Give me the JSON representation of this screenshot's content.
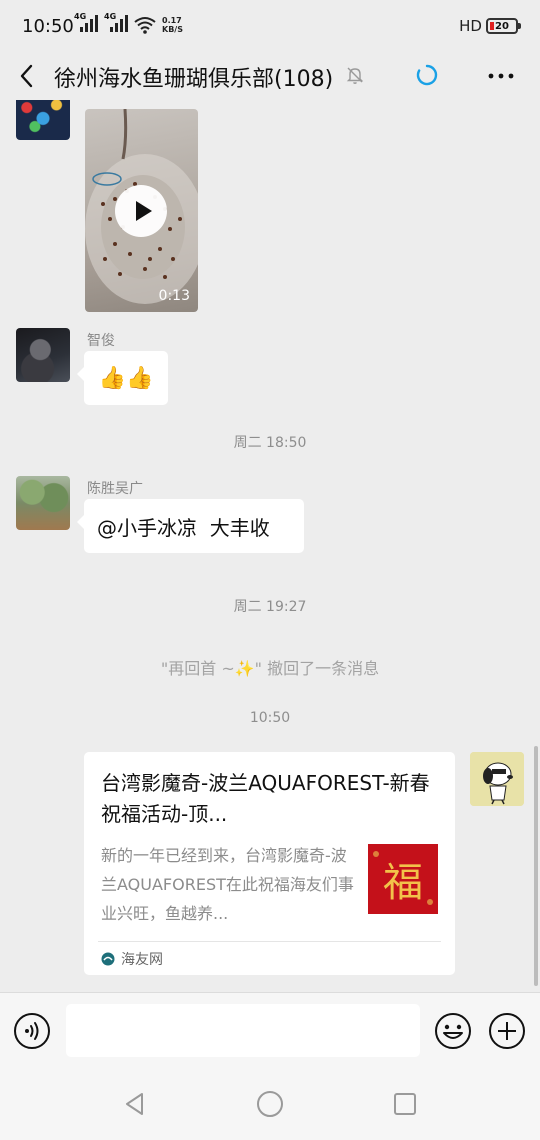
{
  "status_bar": {
    "time": "10:50",
    "network_1": "4G",
    "network_2": "4G",
    "speed_value": "0.17",
    "speed_unit": "KB/S",
    "hd_label": "HD",
    "battery_level": "20"
  },
  "header": {
    "title": "徐州海水鱼珊瑚俱乐部(108)",
    "icons": [
      "back-icon",
      "mute-icon",
      "loading-icon",
      "more-icon"
    ]
  },
  "messages": {
    "video": {
      "duration": "0:13"
    },
    "msg_zhijun": {
      "sender": "智俊",
      "content": "👍👍"
    },
    "time_1": "周二 18:50",
    "msg_chensheng": {
      "sender": "陈胜吴广",
      "content": "@小手冰凉  大丰收"
    },
    "time_2": "周二 19:27",
    "recall_notice": "\"再回首 ~✨\" 撤回了一条消息",
    "time_3": "10:50",
    "share_card": {
      "title": "台湾影魔奇-波兰AQUAFOREST-新春祝福活动-顶...",
      "description": "新的一年已经到来，台湾影魔奇-波兰AQUAFOREST在此祝福海友们事业兴旺，鱼越养...",
      "thumb_char": "福",
      "source": "海友网"
    }
  },
  "input_bar": {
    "value": "",
    "placeholder": ""
  },
  "colors": {
    "chat_bg": "#ededed",
    "bubble": "#ffffff",
    "timestamp": "#8e8e8e",
    "accent_loading": "#1aa1e6",
    "thumb_red": "#c4111a"
  }
}
